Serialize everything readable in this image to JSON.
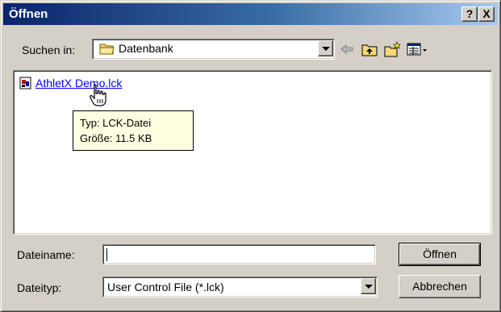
{
  "window": {
    "title": "Öffnen",
    "help_label": "?",
    "close_label": "X"
  },
  "look_in": {
    "label": "Suchen in:",
    "value": "Datenbank"
  },
  "toolbar": {
    "back_icon": "back-arrow-icon",
    "up_icon": "up-folder-icon",
    "new_folder_icon": "new-folder-icon",
    "view_menu_icon": "view-menu-icon"
  },
  "files": [
    {
      "name": "AthletX Demo.lck"
    }
  ],
  "tooltip": {
    "type_line": "Typ: LCK-Datei",
    "size_line": "Größe: 11.5 KB"
  },
  "filename": {
    "label": "Dateiname:",
    "value": ""
  },
  "filetype": {
    "label": "Dateityp:",
    "value": "User Control File (*.lck)"
  },
  "buttons": {
    "open": "Öffnen",
    "cancel": "Abbrechen"
  }
}
